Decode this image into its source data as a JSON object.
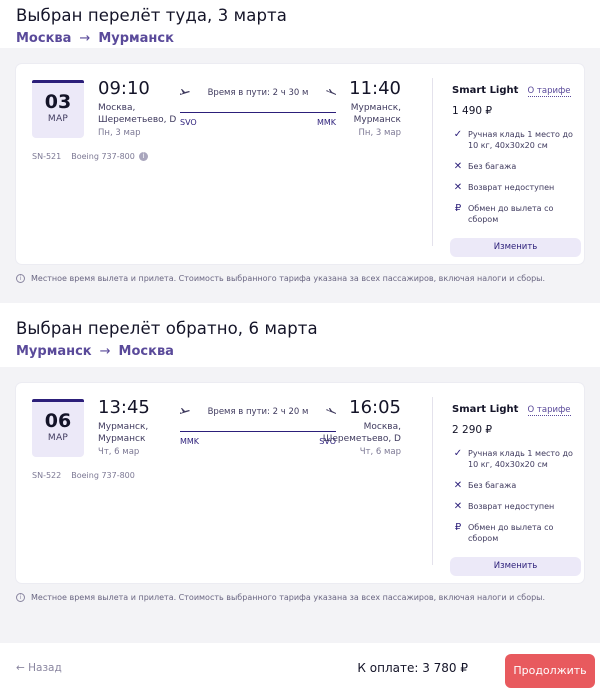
{
  "outbound": {
    "title": "Выбран перелёт туда, 3 марта",
    "route_from": "Москва",
    "route_to": "Мурманск",
    "date_day": "03",
    "date_month": "МАР",
    "dep_time": "09:10",
    "dep_place_1": "Москва,",
    "dep_place_2": "Шереметьево, D",
    "dep_day": "Пн, 3 мар",
    "duration": "Время в пути: 2 ч 30 м",
    "code_from": "SVO",
    "code_to": "MMK",
    "arr_time": "11:40",
    "arr_place_1": "Мурманск,",
    "arr_place_2": "Мурманск",
    "arr_day": "Пн, 3 мар",
    "flight_no": "SN-521",
    "aircraft": "Boeing 737-800",
    "tariff_name": "Smart Light",
    "tariff_link": "О тарифе",
    "price": "1 490 ₽",
    "features": [
      {
        "icon": "check-icon",
        "text_1": "Ручная кладь 1 место до",
        "text_2": "10 кг, 40х30х20 см"
      },
      {
        "icon": "cross-icon",
        "text_1": "Без багажа",
        "text_2": ""
      },
      {
        "icon": "cross-icon",
        "text_1": "Возврат недоступен",
        "text_2": ""
      },
      {
        "icon": "ruble-icon",
        "text_1": "Обмен до вылета со",
        "text_2": "сбором"
      }
    ],
    "change_label": "Изменить",
    "note": "Местное время вылета и прилета. Стоимость выбранного тарифа указана за всех пассажиров, включая налоги и сборы."
  },
  "return": {
    "title": "Выбран перелёт обратно, 6 марта",
    "route_from": "Мурманск",
    "route_to": "Москва",
    "date_day": "06",
    "date_month": "МАР",
    "dep_time": "13:45",
    "dep_place_1": "Мурманск,",
    "dep_place_2": "Мурманск",
    "dep_day": "Чт, 6 мар",
    "duration": "Время в пути: 2 ч 20 м",
    "code_from": "MMK",
    "code_to": "SVO",
    "arr_time": "16:05",
    "arr_place_1": "Москва,",
    "arr_place_2": "Шереметьево, D",
    "arr_day": "Чт, 6 мар",
    "flight_no": "SN-522",
    "aircraft": "Boeing 737-800",
    "tariff_name": "Smart Light",
    "tariff_link": "О тарифе",
    "price": "2 290 ₽",
    "features": [
      {
        "icon": "check-icon",
        "text_1": "Ручная кладь 1 место до",
        "text_2": "10 кг, 40х30х20 см"
      },
      {
        "icon": "cross-icon",
        "text_1": "Без багажа",
        "text_2": ""
      },
      {
        "icon": "cross-icon",
        "text_1": "Возврат недоступен",
        "text_2": ""
      },
      {
        "icon": "ruble-icon",
        "text_1": "Обмен до вылета со",
        "text_2": "сбором"
      }
    ],
    "change_label": "Изменить",
    "note": "Местное время вылета и прилета. Стоимость выбранного тарифа указана за всех пассажиров, включая налоги и сборы."
  },
  "footer": {
    "back_label": "← Назад",
    "total_label": "К оплате: 3 780 ₽",
    "continue_label": "Продолжить"
  },
  "colors": {
    "accent": "#2c1f7a",
    "cta": "#e85a5e",
    "date_bg": "#ece9f8"
  }
}
